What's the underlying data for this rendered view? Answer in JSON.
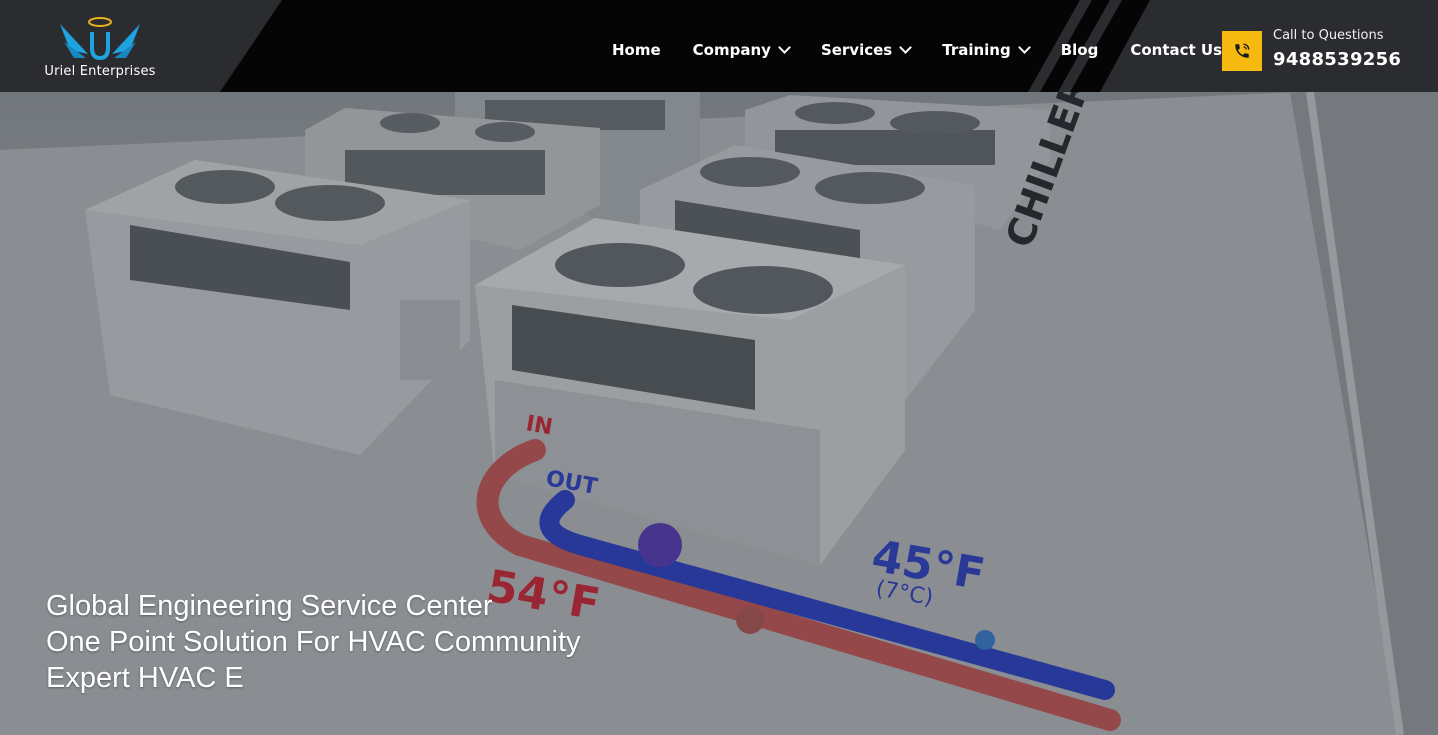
{
  "brand": {
    "name": "Uriel Enterprises"
  },
  "nav": {
    "items": [
      {
        "label": "Home",
        "has_dropdown": false
      },
      {
        "label": "Company",
        "has_dropdown": true
      },
      {
        "label": "Services",
        "has_dropdown": true
      },
      {
        "label": "Training",
        "has_dropdown": true
      },
      {
        "label": "Blog",
        "has_dropdown": false
      },
      {
        "label": "Contact Us",
        "has_dropdown": false
      }
    ]
  },
  "contact": {
    "label": "Call to Questions",
    "phone": "9488539256",
    "icon": "phone-icon"
  },
  "hero": {
    "lines": [
      "Global Engineering Service Center",
      "One Point Solution For HVAC Community",
      "Expert HVAC E"
    ],
    "scene_labels": {
      "chillers": "CHILLERS",
      "in": "IN",
      "out": "OUT",
      "temp_out": "45°F",
      "temp_out_c": "(7°C)",
      "temp_in": "54°F"
    }
  },
  "colors": {
    "header_bg": "#2b2c30",
    "accent": "#f5b90f",
    "text": "#ffffff",
    "logo_blue": "#1fa3e0",
    "logo_gold": "#e8b21a"
  }
}
